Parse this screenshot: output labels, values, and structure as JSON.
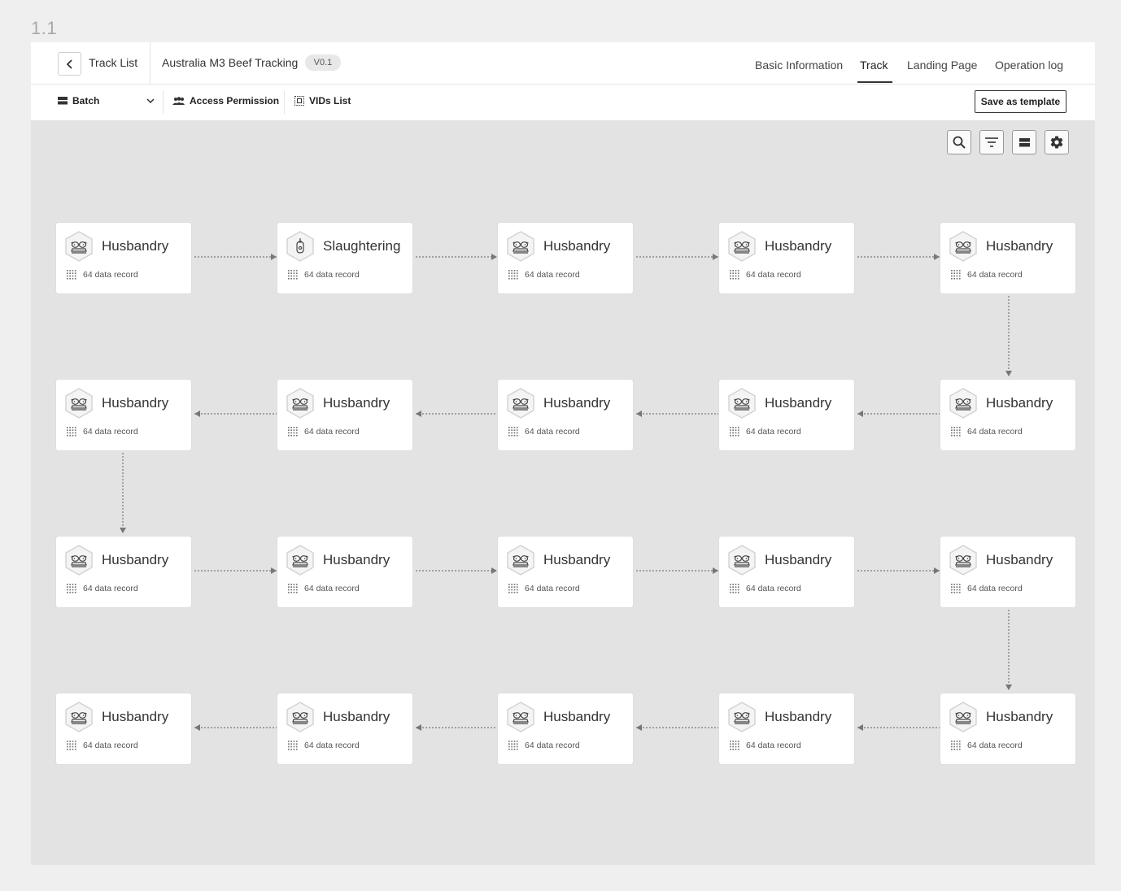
{
  "frame_label": "1.1",
  "header": {
    "back_label": "Track List",
    "project_title": "Australia M3 Beef Tracking",
    "version": "V0.1",
    "tabs": [
      {
        "label": "Basic Information",
        "active": false
      },
      {
        "label": "Track",
        "active": true
      },
      {
        "label": "Landing Page",
        "active": false
      },
      {
        "label": "Operation log",
        "active": false
      }
    ]
  },
  "toolbar": {
    "batch_label": "Batch",
    "access_label": "Access Permission",
    "vids_label": "VIDs List",
    "save_label": "Save as template"
  },
  "canvas_tools": [
    "search-icon",
    "filter-icon",
    "layout-icon",
    "gear-icon"
  ],
  "flow": {
    "rows": [
      {
        "direction": "ltr",
        "nodes": [
          {
            "title": "Husbandry",
            "subtitle": "64 data record",
            "icon": "cattle-icon"
          },
          {
            "title": "Slaughtering",
            "subtitle": "64 data record",
            "icon": "slaughter-icon"
          },
          {
            "title": "Husbandry",
            "subtitle": "64 data record",
            "icon": "cattle-icon"
          },
          {
            "title": "Husbandry",
            "subtitle": "64 data record",
            "icon": "cattle-icon"
          },
          {
            "title": "Husbandry",
            "subtitle": "64 data record",
            "icon": "cattle-icon"
          }
        ]
      },
      {
        "direction": "rtl",
        "nodes": [
          {
            "title": "Husbandry",
            "subtitle": "64 data record",
            "icon": "cattle-icon"
          },
          {
            "title": "Husbandry",
            "subtitle": "64 data record",
            "icon": "cattle-icon"
          },
          {
            "title": "Husbandry",
            "subtitle": "64 data record",
            "icon": "cattle-icon"
          },
          {
            "title": "Husbandry",
            "subtitle": "64 data record",
            "icon": "cattle-icon"
          },
          {
            "title": "Husbandry",
            "subtitle": "64 data record",
            "icon": "cattle-icon"
          }
        ]
      },
      {
        "direction": "ltr",
        "nodes": [
          {
            "title": "Husbandry",
            "subtitle": "64 data record",
            "icon": "cattle-icon"
          },
          {
            "title": "Husbandry",
            "subtitle": "64 data record",
            "icon": "cattle-icon"
          },
          {
            "title": "Husbandry",
            "subtitle": "64 data record",
            "icon": "cattle-icon"
          },
          {
            "title": "Husbandry",
            "subtitle": "64 data record",
            "icon": "cattle-icon"
          },
          {
            "title": "Husbandry",
            "subtitle": "64 data record",
            "icon": "cattle-icon"
          }
        ]
      },
      {
        "direction": "rtl",
        "nodes": [
          {
            "title": "Husbandry",
            "subtitle": "64 data record",
            "icon": "cattle-icon"
          },
          {
            "title": "Husbandry",
            "subtitle": "64 data record",
            "icon": "cattle-icon"
          },
          {
            "title": "Husbandry",
            "subtitle": "64 data record",
            "icon": "cattle-icon"
          },
          {
            "title": "Husbandry",
            "subtitle": "64 data record",
            "icon": "cattle-icon"
          },
          {
            "title": "Husbandry",
            "subtitle": "64 data record",
            "icon": "cattle-icon"
          }
        ]
      }
    ]
  },
  "colors": {
    "canvas": "#e3e3e3",
    "node": "#ffffff",
    "connector": "#777777",
    "text": "#333333"
  }
}
